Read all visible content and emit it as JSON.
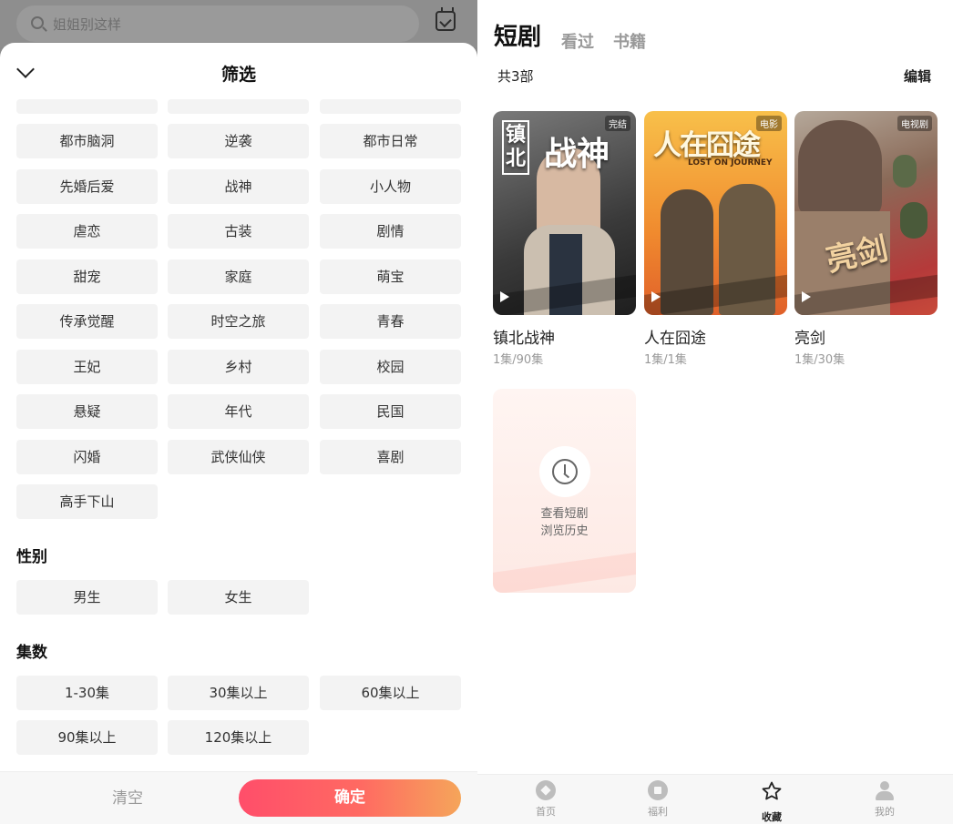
{
  "filter_panel": {
    "search_placeholder": "姐姐别这样",
    "title": "筛选",
    "genre_tags": [
      "都市脑洞",
      "逆袭",
      "都市日常",
      "先婚后爱",
      "战神",
      "小人物",
      "虐恋",
      "古装",
      "剧情",
      "甜宠",
      "家庭",
      "萌宝",
      "传承觉醒",
      "时空之旅",
      "青春",
      "王妃",
      "乡村",
      "校园",
      "悬疑",
      "年代",
      "民国",
      "闪婚",
      "武侠仙侠",
      "喜剧",
      "高手下山"
    ],
    "gender_title": "性别",
    "gender_tags": [
      "男生",
      "女生"
    ],
    "episodes_title": "集数",
    "episode_tags": [
      "1-30集",
      "30集以上",
      "60集以上",
      "90集以上",
      "120集以上"
    ],
    "clear_label": "清空",
    "confirm_label": "确定"
  },
  "library": {
    "tabs": [
      "短剧",
      "看过",
      "书籍"
    ],
    "count_text": "共3部",
    "edit_label": "编辑",
    "items": [
      {
        "title": "镇北战神",
        "episodes": "1集/90集",
        "badge": "完结",
        "poster_text_a": "镇北",
        "poster_text_b": "战神",
        "color_top": "#6b6b6b",
        "color_bottom": "#2a2a2a"
      },
      {
        "title": "人在囧途",
        "episodes": "1集/1集",
        "badge": "电影",
        "poster_text_a": "人在囧途",
        "poster_text_b": "LOST ON JOURNEY",
        "color_top": "#f7b544",
        "color_bottom": "#e2622a"
      },
      {
        "title": "亮剑",
        "episodes": "1集/30集",
        "badge": "电视剧",
        "poster_text_a": "亮剑",
        "poster_text_b": "",
        "color_top": "#8a4c3c",
        "color_bottom": "#c23a3a"
      }
    ],
    "history_text_1": "查看短剧",
    "history_text_2": "浏览历史"
  },
  "bottom_nav": [
    {
      "label": "首页",
      "icon": "compass-icon"
    },
    {
      "label": "福利",
      "icon": "gift-icon"
    },
    {
      "label": "收藏",
      "icon": "star-icon"
    },
    {
      "label": "我的",
      "icon": "user-icon"
    }
  ]
}
